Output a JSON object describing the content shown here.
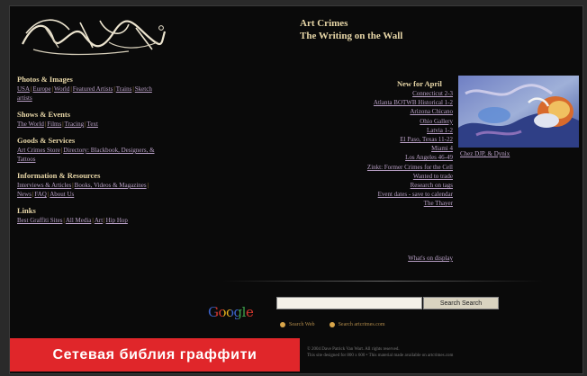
{
  "site": {
    "title_line1": "Art Crimes",
    "title_line2": "The Writing on the Wall"
  },
  "sections": [
    {
      "title": "Photos & Images",
      "links": [
        "USA",
        "Europe",
        "World",
        "Featured Artists",
        "Trains",
        "Sketch",
        "artists"
      ]
    },
    {
      "title": "Shows & Events",
      "links": [
        "The World",
        "Films",
        "Tracing",
        "Text"
      ]
    },
    {
      "title": "Goods & Services",
      "links": [
        "Art Crimes Store",
        "Directory: Blackbook, Designers, &",
        "Tattoos"
      ]
    },
    {
      "title": "Information & Resources",
      "links": [
        "Interviews & Articles",
        "Books, Videos & Magazines",
        "News",
        "FAQ",
        "About Us"
      ]
    },
    {
      "title": "Links",
      "links": [
        "Best Graffiti Sites",
        "All Media",
        "Art",
        "Hip Hop"
      ]
    }
  ],
  "new_for_april": {
    "title": "New for April",
    "items": [
      "Connecticut 2-3",
      "Atlanta BOTWB Historical 1-2",
      "Arizona Chicano",
      "Ohio Gallery",
      "Latvia 1-2",
      "El Paso, Texas 11-22",
      "Miami 4",
      "Los Angeles 46-49",
      "Zinkt: Former Crimes for the Cell",
      "Wanted to trade",
      "Research on tags",
      "Event dates - save to calendar",
      "The Thayer"
    ],
    "more": "What's on display"
  },
  "feature": {
    "caption": "Chez DJP, & Dynix",
    "image_icon": "graffiti-artwork-image"
  },
  "search": {
    "logo": "Google",
    "input_value": "",
    "button_label": "Search Search",
    "options": [
      "Search Web",
      "Search artcrimes.com"
    ]
  },
  "footer": {
    "line1": "© 2004 Dave Patrick Van Wart. All rights reserved.",
    "line2": "This site designed for 800 x 600 • This material made available on artcrimes.com"
  },
  "overlay": {
    "label": "Сетевая библия граффити"
  },
  "colors": {
    "background": "#0a0a0a",
    "heading": "#e8d7a8",
    "link": "#b9a0c6",
    "separator": "#b08a4a",
    "overlay_red": "#e0262a"
  }
}
